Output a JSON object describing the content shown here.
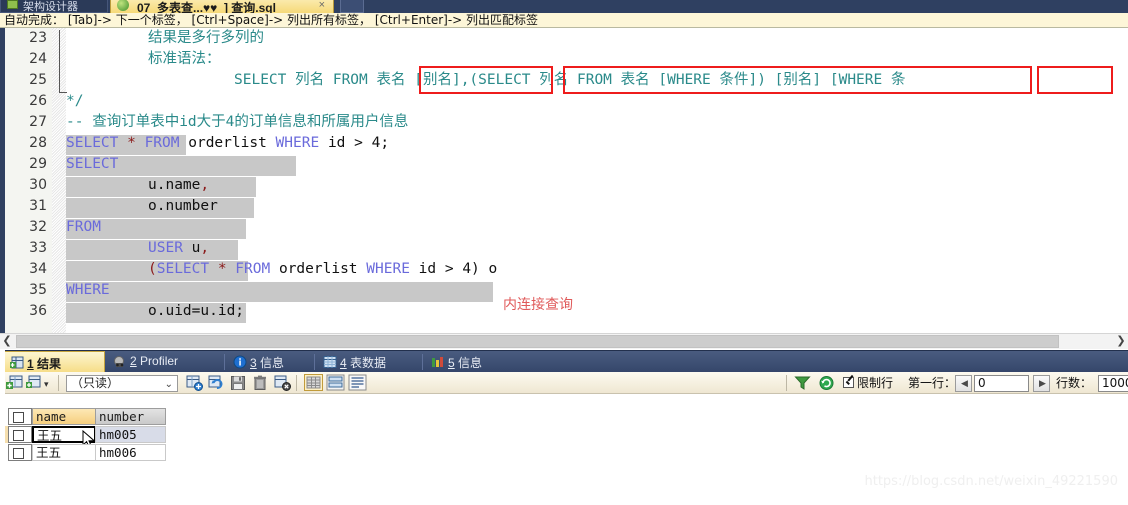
{
  "window": {
    "tabs": [
      {
        "label": "架构设计器",
        "active": false,
        "icon": "diagram-icon"
      },
      {
        "label": "07_多表查...♥♥_] 查询.sql",
        "active": true,
        "icon": "green-globe-icon",
        "close": "×"
      }
    ]
  },
  "hint_bar": {
    "text": "自动完成： [Tab]-> 下一个标签， [Ctrl+Space]-> 列出所有标签， [Ctrl+Enter]-> 列出匹配标签"
  },
  "editor": {
    "first_line_number": 23,
    "line_numbers": [
      23,
      24,
      25,
      26,
      27,
      28,
      29,
      30,
      31,
      32,
      33,
      34,
      35,
      36
    ],
    "lines": [
      {
        "n": 23,
        "indent": 6,
        "text": "结果是多行多列的",
        "kind": "comment"
      },
      {
        "n": 24,
        "indent": 6,
        "text": "标准语法：",
        "kind": "comment"
      },
      {
        "n": 25,
        "indent": 11,
        "text": "SELECT 列名 FROM 表名 [别名],(SELECT 列名 FROM 表名 [WHERE 条件]) [别名] [WHERE 条",
        "kind": "comment"
      },
      {
        "n": 26,
        "indent": 0,
        "text": "*/",
        "kind": "comment"
      },
      {
        "n": 27,
        "indent": 0,
        "text": "-- 查询订单表中id大于4的订单信息和所属用户信息",
        "kind": "comment"
      },
      {
        "n": 28,
        "indent": 0,
        "text": "SELECT * FROM orderlist WHERE id > 4;",
        "kind": "sql"
      },
      {
        "n": 29,
        "indent": 0,
        "text": "SELECT",
        "kind": "sql"
      },
      {
        "n": 30,
        "indent": 4,
        "text": "u.name,",
        "kind": "sql"
      },
      {
        "n": 31,
        "indent": 4,
        "text": "o.number",
        "kind": "sql"
      },
      {
        "n": 32,
        "indent": 0,
        "text": "FROM",
        "kind": "sql"
      },
      {
        "n": 33,
        "indent": 4,
        "text": "USER u,",
        "kind": "sql"
      },
      {
        "n": 34,
        "indent": 4,
        "text": "(SELECT * FROM orderlist WHERE id > 4) o",
        "kind": "sql"
      },
      {
        "n": 35,
        "indent": 0,
        "text": "WHERE",
        "kind": "sql"
      },
      {
        "n": 36,
        "indent": 4,
        "text": "o.uid=u.id;",
        "kind": "sql"
      }
    ],
    "annotation": "内连接查询",
    "syntax_colors": {
      "keyword": "#6a6adb",
      "comment": "#2a8a8a",
      "star": "#8b1a1a",
      "plain": "#111111",
      "selection": "#c8c8c8",
      "annotation": "#e05a5a",
      "redbox": "#ee1c1c"
    },
    "red_boxes": 3
  },
  "line25_segments": [
    {
      "t": "SELECT ",
      "c": "cmt"
    },
    {
      "t": "列名 ",
      "c": "cmt"
    },
    {
      "t": "FROM ",
      "c": "cmt"
    },
    {
      "t": "表名 [别名],",
      "c": "cmt"
    },
    {
      "t": "(SELECT 列名 FROM 表名 [WHERE 条件]) [别名]",
      "c": "cmt"
    },
    {
      "t": " [WHERE 条",
      "c": "cmt"
    }
  ],
  "scrollbar": {
    "left_arrow": "❮",
    "right_arrow": "❯"
  },
  "result_tabs": [
    {
      "num": "1",
      "label": "结果",
      "icon": "grid-green-icon",
      "active": true
    },
    {
      "num": "2",
      "label": "Profiler",
      "icon": "profiler-icon",
      "active": false
    },
    {
      "num": "3",
      "label": "信息",
      "icon": "info-blue-icon",
      "active": false
    },
    {
      "num": "4",
      "label": "表数据",
      "icon": "table-blue-icon",
      "active": false
    },
    {
      "num": "5",
      "label": "信息",
      "icon": "chart-icon",
      "active": false
    }
  ],
  "result_toolbar": {
    "mode_select": "（只读）",
    "mode_caret": "⌄",
    "limit_label": "限制行",
    "first_row_label": "第一行：",
    "first_row_value": "0",
    "rowcount_label": "行数：",
    "rowcount_value": "1000",
    "prev_arrow": "◀",
    "next_arrow": "▶",
    "icons": [
      "insert-row-icon",
      "insert-row-dropdown-icon",
      "new-record-icon",
      "refresh-record-icon",
      "save-icon",
      "delete-icon",
      "cancel-edit-icon",
      "grid-view-icon",
      "form-view-icon",
      "text-view-icon",
      "filter-icon",
      "refresh-icon"
    ]
  },
  "grid": {
    "columns": [
      "name",
      "number"
    ],
    "rows": [
      {
        "name": "王五",
        "number": "hm005",
        "selected": true
      },
      {
        "name": "王五",
        "number": "hm006",
        "selected": false
      }
    ]
  },
  "watermark": "https://blog.csdn.net/weixin_49221590"
}
